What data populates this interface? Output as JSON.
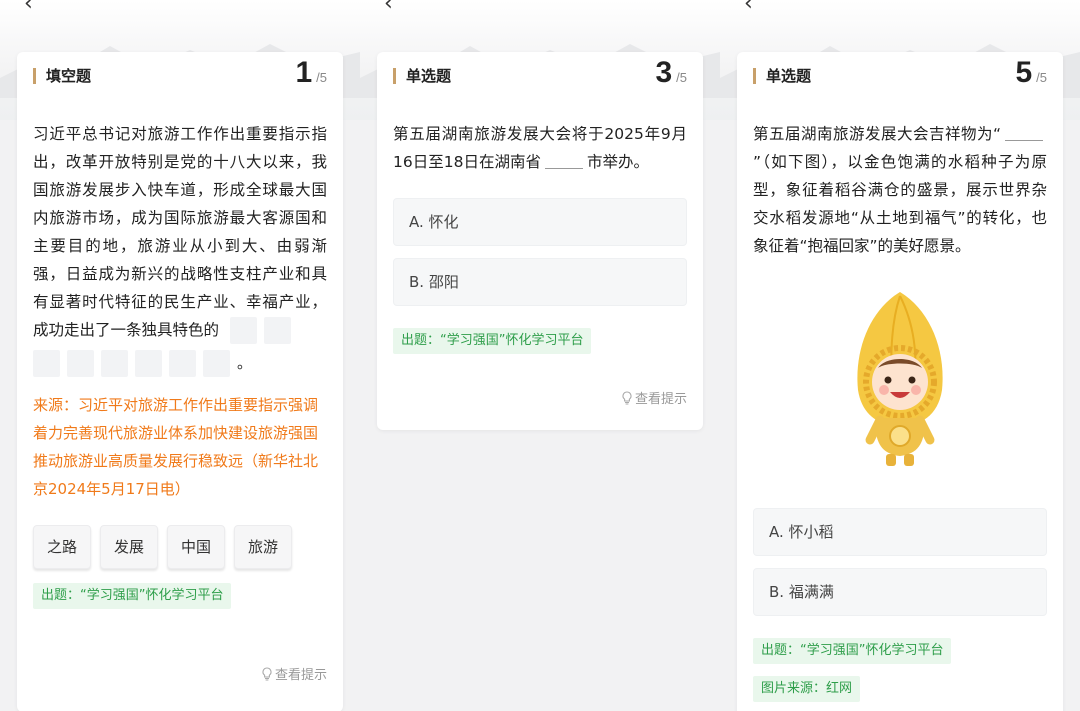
{
  "panels": [
    {
      "qtype": "填空题",
      "qnum": "1",
      "qtotal": "/5",
      "question": "习近平总书记对旅游工作作出重要指示指出，改革开放特别是党的十八大以来，我国旅游发展步入快车道，形成全球最大国内旅游市场，成为国际旅游最大客源国和主要目的地，旅游业从小到大、由弱渐强，日益成为新兴的战略性支柱产业和具有显著时代特征的民生产业、幸福产业，",
      "question_tail": "成功走出了一条独具特色的",
      "period": "。",
      "source": "来源：习近平对旅游工作作出重要指示强调 着力完善现代旅游业体系加快建设旅游强国 推动旅游业高质量发展行稳致远（新华社北京2024年5月17日电）",
      "words": [
        "之路",
        "发展",
        "中国",
        "旅游"
      ],
      "tag": "出题：“学习强国”怀化学习平台",
      "hint": "查看提示"
    },
    {
      "qtype": "单选题",
      "qnum": "3",
      "qtotal": "/5",
      "question_a": "第五届湖南旅游发展大会将于2025年9月16日至18日在湖南省",
      "question_b": "市举办。",
      "options": [
        "A. 怀化",
        "B. 邵阳"
      ],
      "tag": "出题：“学习强国”怀化学习平台",
      "hint": "查看提示"
    },
    {
      "qtype": "单选题",
      "qnum": "5",
      "qtotal": "/5",
      "question_a": "第五届湖南旅游发展大会吉祥物为“",
      "question_b": "”（如下图），以金色饱满的水稻种子为原型，象征着稻谷满仓的盛景，展示世界杂交水稻发源地“从土地到福气”的转化，也象征着“抱福回家”的美好愿景。",
      "options": [
        "A. 怀小稻",
        "B. 福满满"
      ],
      "tag": "出题：“学习强国”怀化学习平台",
      "tag2": "图片来源：红网"
    }
  ],
  "colors": {
    "accent_bar": "#c8a06a",
    "source_text": "#f07a1a",
    "tag_text": "#2e9e4a",
    "tag_bg": "#e9f7ec"
  },
  "icons": [
    "back-arrow-icon",
    "lightbulb-icon",
    "mascot-image"
  ]
}
